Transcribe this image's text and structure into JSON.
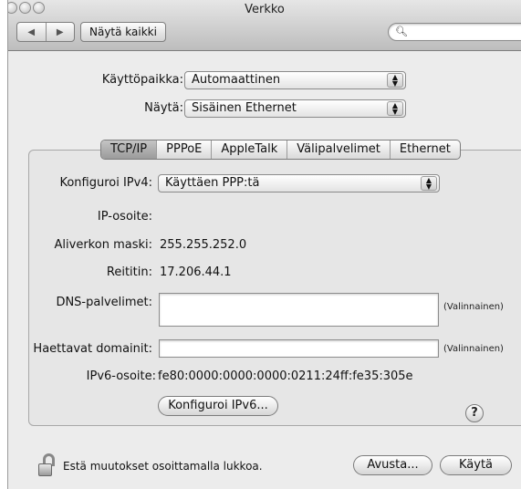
{
  "window": {
    "title": "Verkko"
  },
  "toolbar": {
    "show_all_label": "Näytä kaikki",
    "search_placeholder": ""
  },
  "location": {
    "label": "Käyttöpaikka:",
    "value": "Automaattinen"
  },
  "show": {
    "label": "Näytä:",
    "value": "Sisäinen Ethernet"
  },
  "tabs": [
    {
      "label": "TCP/IP",
      "active": true
    },
    {
      "label": "PPPoE",
      "active": false
    },
    {
      "label": "AppleTalk",
      "active": false
    },
    {
      "label": "Välipalvelimet",
      "active": false
    },
    {
      "label": "Ethernet",
      "active": false
    }
  ],
  "tcpip": {
    "configure_ipv4_label": "Konfiguroi IPv4:",
    "configure_ipv4_value": "Käyttäen PPP:tä",
    "ip_label": "IP-osoite:",
    "ip_value": "",
    "subnet_label": "Aliverkon maski:",
    "subnet_value": "255.255.252.0",
    "router_label": "Reititin:",
    "router_value": "17.206.44.1",
    "dns_label": "DNS-palvelimet:",
    "dns_value": "",
    "dns_hint": "(Valinnainen)",
    "search_domains_label": "Haettavat domainit:",
    "search_domains_value": "",
    "search_domains_hint": "(Valinnainen)",
    "ipv6_label": "IPv6-osoite:",
    "ipv6_value": "fe80:0000:0000:0000:0211:24ff:fe35:305e",
    "configure_ipv6_label": "Konfiguroi IPv6...",
    "help_label": "?"
  },
  "footer": {
    "lock_text": "Estä muutokset osoittamalla lukkoa.",
    "assist_label": "Avusta...",
    "apply_label": "Käytä"
  }
}
